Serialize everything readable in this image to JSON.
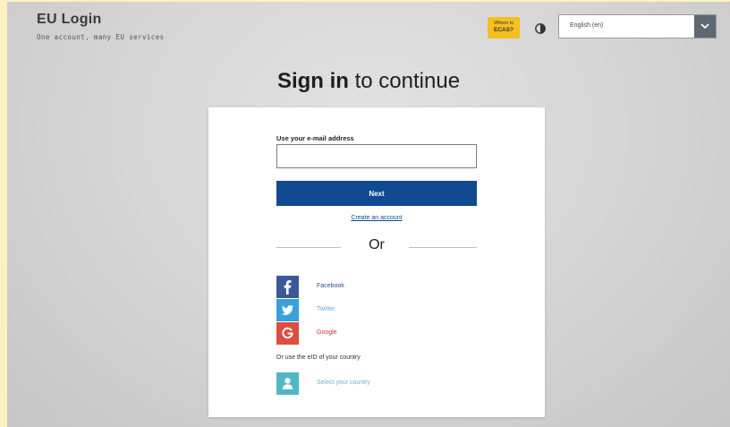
{
  "header": {
    "brand_title": "EU Login",
    "brand_tagline": "One account, many EU services",
    "ecas_line1": "Where is",
    "ecas_line2": "ECAS?",
    "language_selected": "English (en)"
  },
  "main": {
    "title_bold": "Sign in",
    "title_rest": " to continue"
  },
  "form": {
    "email_label": "Use your e-mail address",
    "email_value": "",
    "next_label": "Next",
    "create_account_label": "Create an account",
    "or_label": "Or"
  },
  "social": {
    "facebook_label": "Facebook",
    "twitter_label": "Twitter",
    "google_label": "Google",
    "eid_text": "Or use the eID of your country",
    "eid_label": "Select your country"
  },
  "colors": {
    "primary": "#104a91",
    "ecas_badge": "#f4c020",
    "facebook": "#3b5998",
    "twitter": "#3aa1dc",
    "google": "#dc4e41",
    "eid": "#51b7c4"
  },
  "icons": [
    "contrast-icon",
    "chevron-down-icon",
    "facebook-icon",
    "twitter-icon",
    "google-icon",
    "person-icon"
  ]
}
